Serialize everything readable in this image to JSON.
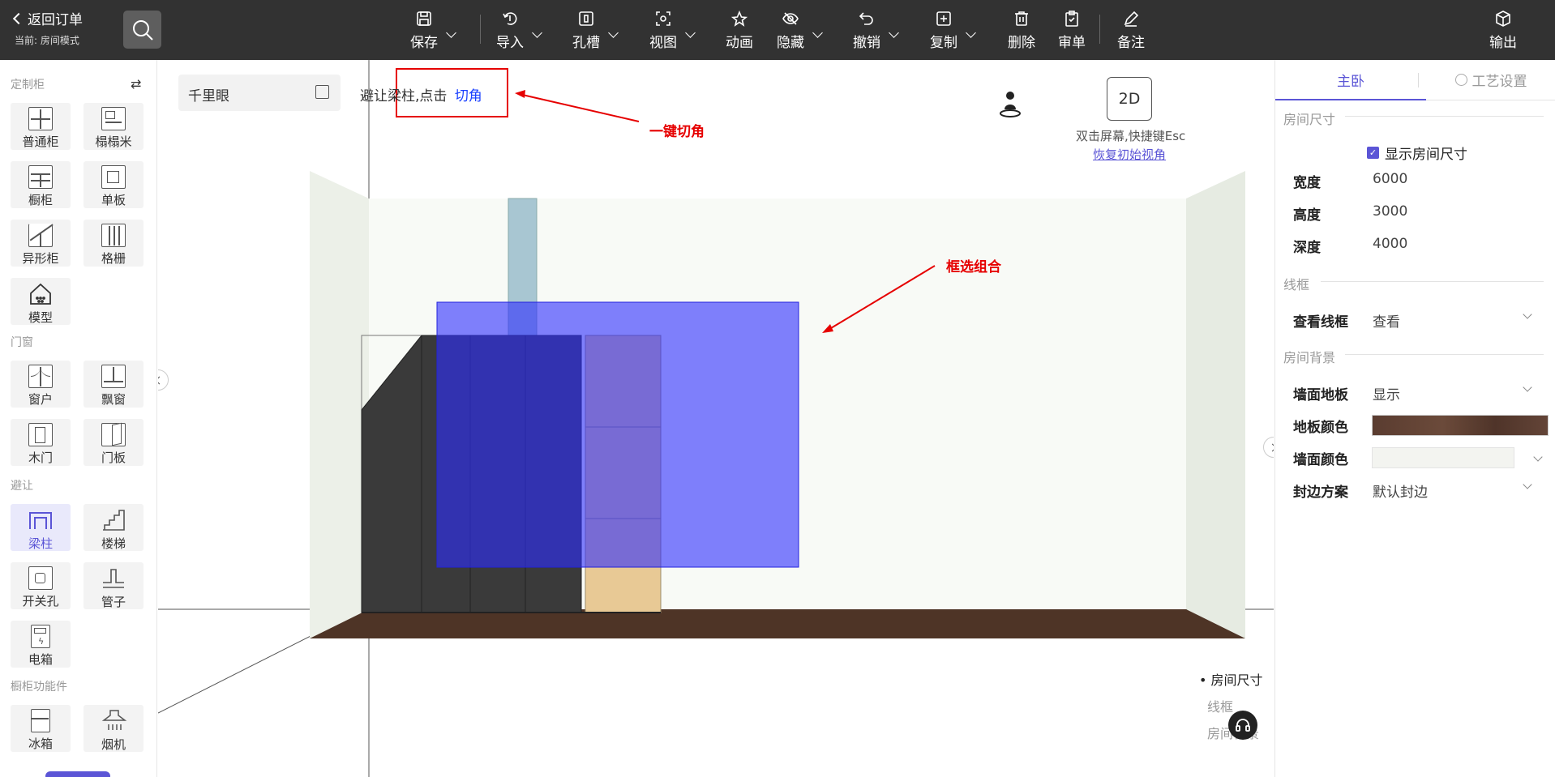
{
  "topbar": {
    "back_label": "返回订单",
    "mode_label": "当前: 房间模式",
    "buttons": [
      {
        "label": "保存",
        "icon": "save-icon"
      },
      {
        "label": "导入",
        "icon": "import-icon"
      },
      {
        "label": "孔槽",
        "icon": "slot-icon"
      },
      {
        "label": "视图",
        "icon": "view-icon"
      },
      {
        "label": "动画",
        "icon": "animation-icon"
      },
      {
        "label": "隐藏",
        "icon": "hide-icon"
      },
      {
        "label": "撤销",
        "icon": "undo-icon"
      },
      {
        "label": "复制",
        "icon": "copy-icon"
      },
      {
        "label": "删除",
        "icon": "trash-icon"
      },
      {
        "label": "审单",
        "icon": "review-icon"
      },
      {
        "label": "备注",
        "icon": "note-icon"
      },
      {
        "label": "输出",
        "icon": "export-icon"
      }
    ]
  },
  "sidebar": {
    "sections": [
      "定制柜",
      "门窗",
      "避让",
      "橱柜功能件"
    ],
    "items": [
      "普通柜",
      "榻榻米",
      "橱柜",
      "单板",
      "异形柜",
      "格栅",
      "模型",
      "窗户",
      "飘窗",
      "木门",
      "门板",
      "梁柱",
      "楼梯",
      "开关孔",
      "管子",
      "电箱",
      "冰箱",
      "烟机"
    ]
  },
  "canvas": {
    "panorama_label": "千里眼",
    "hint_text": "避让梁柱,点击",
    "hint_link": "切角",
    "annotation_corner": "一键切角",
    "annotation_select": "框选组合",
    "view_toggle": "2D",
    "dbl_click_hint": "双击屏幕,快捷键Esc",
    "reset_view": "恢复初始视角",
    "nav": [
      "房间尺寸",
      "线框",
      "房间背景"
    ]
  },
  "panel": {
    "tab_active": "主卧",
    "tab_settings": "工艺设置",
    "room_size_title": "房间尺寸",
    "show_room_size": "显示房间尺寸",
    "fields": [
      {
        "label": "宽度",
        "value": "6000"
      },
      {
        "label": "高度",
        "value": "3000"
      },
      {
        "label": "深度",
        "value": "4000"
      }
    ],
    "wireframe_title": "线框",
    "wireframe_label": "查看线框",
    "wireframe_value": "查看",
    "background_title": "房间背景",
    "wall_floor_label": "墙面地板",
    "wall_floor_value": "显示",
    "floor_color_label": "地板颜色",
    "wall_color_label": "墙面颜色",
    "edge_label": "封边方案",
    "edge_value": "默认封边"
  },
  "colors": {
    "accent": "#5b55d6",
    "topbar": "#323232",
    "annotation": "#e60000",
    "selection": "#2d2dff"
  }
}
